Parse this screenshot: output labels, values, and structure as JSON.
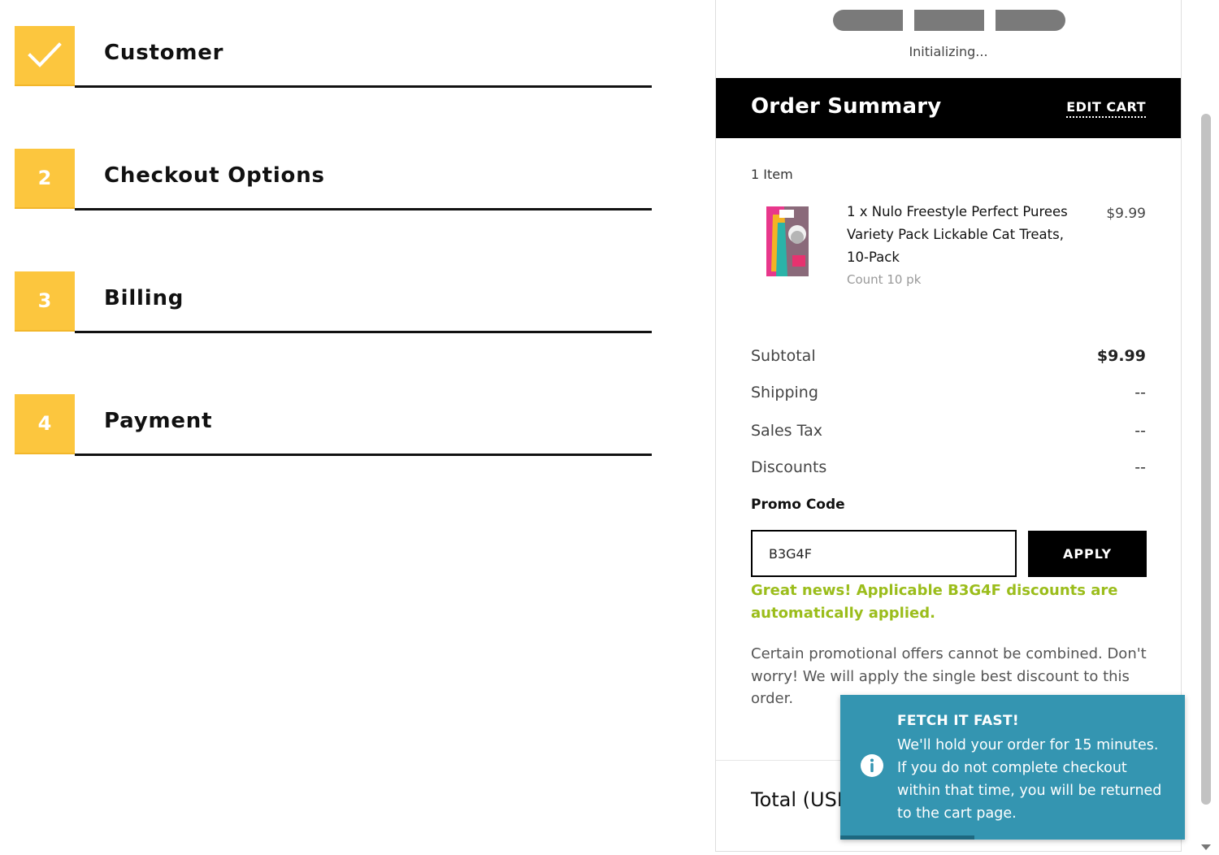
{
  "steps": [
    {
      "badge": "✓",
      "label": "Customer",
      "completed": true
    },
    {
      "badge": "2",
      "label": "Checkout Options",
      "completed": false
    },
    {
      "badge": "3",
      "label": "Billing",
      "completed": false
    },
    {
      "badge": "4",
      "label": "Payment",
      "completed": false
    }
  ],
  "loader": {
    "status": "Initializing..."
  },
  "order_summary": {
    "title": "Order Summary",
    "edit_cart": "EDIT CART",
    "item_count": "1 Item",
    "item": {
      "name": "1 x Nulo Freestyle Perfect Purees Variety Pack Lickable Cat Treats, 10-Pack",
      "price": "$9.99",
      "count": "Count 10 pk"
    },
    "rows": [
      {
        "label": "Subtotal",
        "value": "$9.99"
      },
      {
        "label": "Shipping",
        "value": "--"
      },
      {
        "label": "Sales Tax",
        "value": "--"
      },
      {
        "label": "Discounts",
        "value": "--"
      }
    ],
    "promo": {
      "label": "Promo Code",
      "value": "B3G4F",
      "apply": "APPLY",
      "success": "Great news! Applicable B3G4F discounts are automatically applied.",
      "note": "Certain promotional offers cannot be combined. Don't worry! We will apply the single best discount to this order."
    },
    "total_label": "Total (USD)"
  },
  "toast": {
    "title": "FETCH IT FAST!",
    "message": "We'll hold your order for 15 minutes. If you do not complete checkout within that time, you will be returned to the cart page.",
    "progress_fraction": 0.39
  },
  "colors": {
    "badge": "#fcc63e",
    "success_text": "#9bbd1b",
    "toast_bg": "#3495b1",
    "toast_progress": "#1d6880"
  }
}
